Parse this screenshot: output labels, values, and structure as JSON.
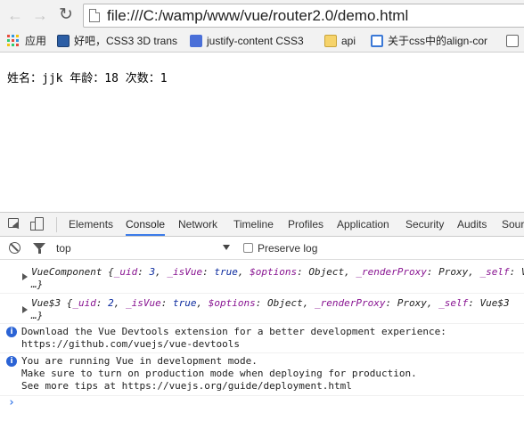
{
  "browser": {
    "url": "file:///C:/wamp/www/vue/router2.0/demo.html"
  },
  "bookmarks": [
    {
      "label": "应用"
    },
    {
      "label": "好吧，CSS3 3D trans"
    },
    {
      "label": "justify-content CSS3"
    },
    {
      "label": "api"
    },
    {
      "label": "关于css中的align-cor"
    }
  ],
  "page": {
    "text": "姓名：jjk 年龄：18 次数：1"
  },
  "devtools": {
    "tabs": [
      "Elements",
      "Console",
      "Network",
      "Timeline",
      "Profiles",
      "Application",
      "Security",
      "Audits",
      "Sour"
    ],
    "active_tab": "Console",
    "context": "top",
    "preserve_log": "Preserve log",
    "messages": {
      "obj1": {
        "name": "VueComponent",
        "p1": " {",
        "k1": "_uid",
        "sep1": ": ",
        "v1": "3",
        "c1": ", ",
        "k2": "_isVue",
        "sep2": ": ",
        "v2": "true",
        "c2": ", ",
        "k3": "$options",
        "sep3": ": ",
        "v3": "Object",
        "c3": ", ",
        "k4": "_renderProxy",
        "sep4": ": ",
        "v4": "Proxy",
        "c4": ", ",
        "k5": "_self",
        "sep5": ": ",
        "v5": "V",
        "more": "…}"
      },
      "obj2": {
        "name": "Vue$3",
        "p1": " {",
        "k1": "_uid",
        "sep1": ": ",
        "v1": "2",
        "c1": ", ",
        "k2": "_isVue",
        "sep2": ": ",
        "v2": "true",
        "c2": ", ",
        "k3": "$options",
        "sep3": ": ",
        "v3": "Object",
        "c3": ", ",
        "k4": "_renderProxy",
        "sep4": ": ",
        "v4": "Proxy",
        "c4": ", ",
        "k5": "_self",
        "sep5": ": ",
        "v5": "Vue$3",
        "more": "…}"
      },
      "info1": [
        "Download the Vue Devtools extension for a better development experience:",
        "https://github.com/vuejs/vue-devtools"
      ],
      "info2": [
        "You are running Vue in development mode.",
        "Make sure to turn on production mode when deploying for production.",
        "See more tips at https://vuejs.org/guide/deployment.html"
      ],
      "prompt": "›"
    }
  },
  "colors": {
    "accent": "#3b7be9",
    "info": "#2b63d5",
    "key": "#881391",
    "value": "#0b2a9e"
  }
}
